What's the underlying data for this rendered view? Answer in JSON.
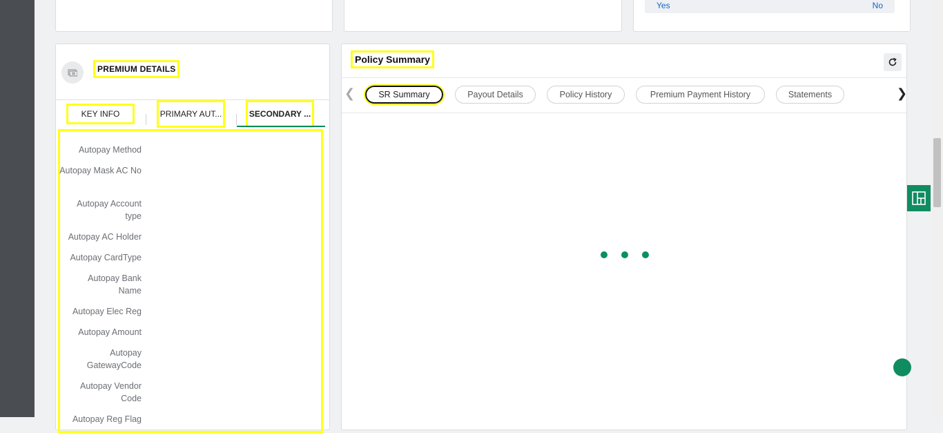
{
  "top_cards": {
    "yes_label": "Yes",
    "no_label": "No"
  },
  "premium": {
    "title": "PREMIUM DETAILS",
    "icon": "money-icon",
    "tabs": [
      "KEY INFO",
      "PRIMARY AUT...",
      "SECONDARY ..."
    ],
    "active_tab": 2,
    "fields": [
      "Autopay Method",
      "Autopay Mask AC No",
      "Autopay Account type",
      "Autopay AC Holder",
      "Autopay CardType",
      "Autopay Bank Name",
      "Autopay Elec Reg",
      "Autopay Amount",
      "Autopay GatewayCode",
      "Autopay Vendor Code",
      "Autopay Reg Flag"
    ]
  },
  "policy": {
    "title": "Policy Summary",
    "tabs": [
      "SR Summary",
      "Payout Details",
      "Policy History",
      "Premium Payment History",
      "Statements"
    ],
    "active_tab": 0,
    "loading": true
  },
  "colors": {
    "accent": "#079062",
    "highlight": "#ffff1a",
    "link": "#1565c0"
  }
}
